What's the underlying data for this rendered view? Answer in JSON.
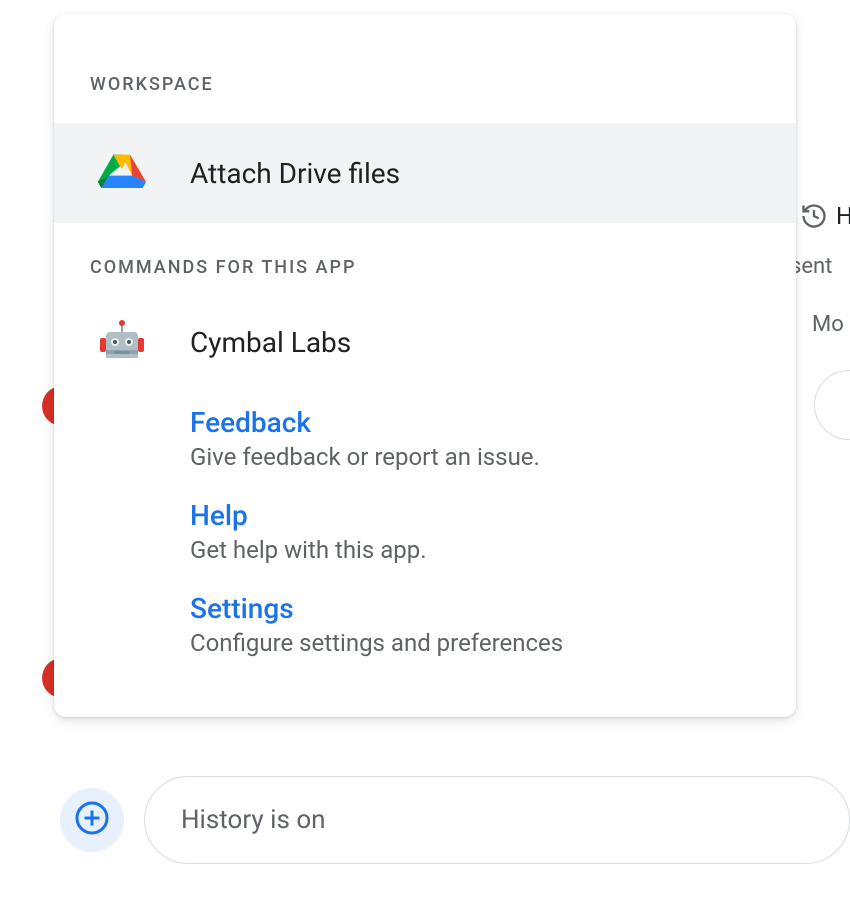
{
  "sections": {
    "workspace_header": "WORKSPACE",
    "commands_header": "COMMANDS FOR THIS APP"
  },
  "drive": {
    "label": "Attach Drive files"
  },
  "app": {
    "name": "Cymbal Labs",
    "commands": [
      {
        "title": "Feedback",
        "desc": "Give feedback or report an issue."
      },
      {
        "title": "Help",
        "desc": "Get help with this app."
      },
      {
        "title": "Settings",
        "desc": "Configure settings and preferences"
      }
    ]
  },
  "composer": {
    "history_label": "History is on"
  },
  "background": {
    "h": "H",
    "sent": "sent",
    "mo": "Mo"
  }
}
